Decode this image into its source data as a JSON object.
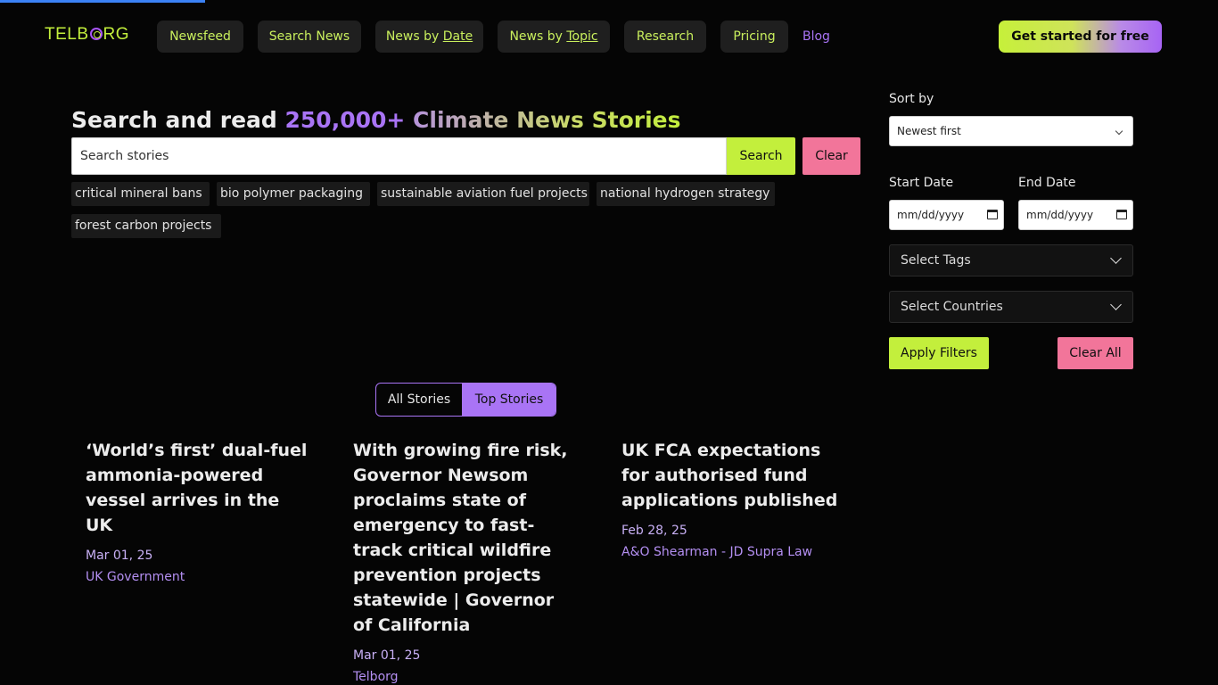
{
  "header": {
    "logo": "TELBORG",
    "logo_parts": [
      "TELB",
      "RG"
    ],
    "nav": [
      {
        "label": "Newsfeed"
      },
      {
        "label": "Search News"
      },
      {
        "label_prefix": "News by ",
        "label_link": "Date"
      },
      {
        "label_prefix": "News by ",
        "label_link": "Topic"
      },
      {
        "label": "Research"
      },
      {
        "label": "Pricing"
      },
      {
        "label": "Blog"
      }
    ],
    "cta_label": "Get started for free"
  },
  "search": {
    "title_prefix": "Search and read ",
    "title_count": "250,000+",
    "title_highlight": " Climate News Stories",
    "placeholder": "Search stories",
    "value": "",
    "search_label": "Search",
    "clear_label": "Clear",
    "suggestions": [
      "critical mineral bans",
      "bio polymer packaging",
      "sustainable aviation fuel projects",
      "national hydrogen strategy",
      "forest carbon projects"
    ]
  },
  "filters": {
    "sort_label": "Sort by",
    "sort_value": "Newest first",
    "start_date_label": "Start Date",
    "end_date_label": "End Date",
    "start_date_value": "mm/dd/yyyy",
    "end_date_value": "mm/dd/yyyy",
    "tags_placeholder": "Select Tags",
    "countries_placeholder": "Select Countries",
    "apply_label": "Apply Filters",
    "clear_all_label": "Clear All"
  },
  "toggle": {
    "all_label": "All Stories",
    "top_label": "Top Stories",
    "selected": "Top Stories"
  },
  "stories": [
    {
      "title": "‘World’s first’ dual-fuel ammonia-powered vessel arrives in the UK",
      "date": "Mar 01, 25",
      "source": "UK Government"
    },
    {
      "title": "With growing fire risk, Governor Newsom proclaims state of emergency to fast-track critical wildfire prevention projects statewide | Governor of California",
      "date": "Mar 01, 25",
      "source": "Telborg"
    },
    {
      "title": "UK FCA expectations for authorised fund applications published",
      "date": "Feb 28, 25",
      "source": "A&O Shearman - JD Supra Law"
    }
  ],
  "colors": {
    "background": "#050505",
    "accent_green": "#c3ef3c",
    "accent_purple": "#a974f5",
    "accent_pink": "#f2759a",
    "progress_blue": "#3b82f6"
  }
}
